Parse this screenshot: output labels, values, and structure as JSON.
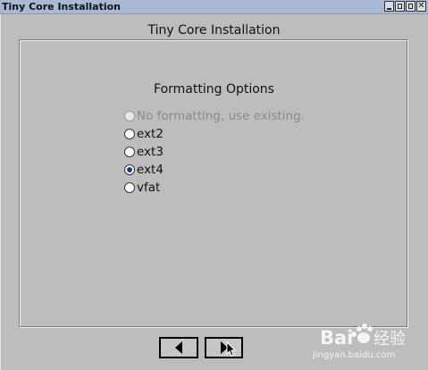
{
  "window": {
    "title": "Tiny Core Installation",
    "controls": [
      "minimize-icon",
      "maximize-icon",
      "close-icon"
    ]
  },
  "page": {
    "title": "Tiny Core Installation"
  },
  "formatting": {
    "title": "Formatting Options",
    "options": [
      {
        "label": "No formatting, use existing.",
        "selected": false,
        "disabled": true
      },
      {
        "label": "ext2",
        "selected": false,
        "disabled": false
      },
      {
        "label": "ext3",
        "selected": false,
        "disabled": false
      },
      {
        "label": "ext4",
        "selected": true,
        "disabled": false
      },
      {
        "label": "vfat",
        "selected": false,
        "disabled": false
      }
    ]
  },
  "navigation": {
    "back_icon": "triangle-left-icon",
    "next_icon": "triangle-right-icon"
  },
  "watermark": {
    "brand": "Bai",
    "brand2": "经验",
    "url": "jingyan.baidu.com"
  },
  "colors": {
    "titlebar": "#a9b9d3",
    "background": "#bdbdbd",
    "radio_selected": "#1f3d8c"
  }
}
